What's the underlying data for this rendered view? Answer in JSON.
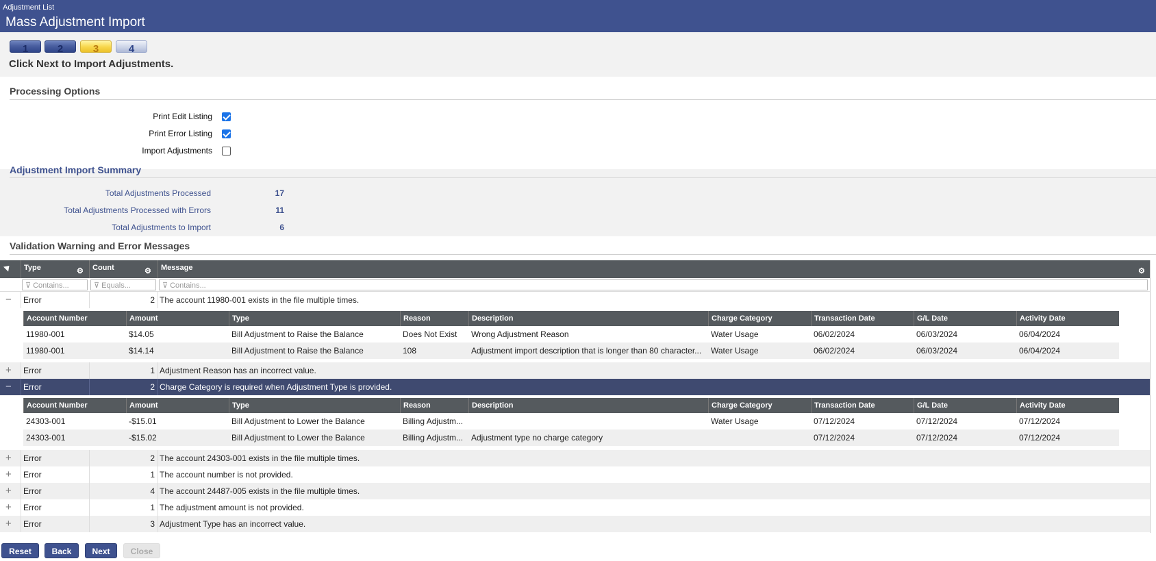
{
  "header": {
    "breadcrumb": "Adjustment List",
    "title": "Mass Adjustment Import"
  },
  "wizard": {
    "steps": [
      "1",
      "2",
      "3",
      "4"
    ],
    "current_step": 3,
    "instruction": "Click Next to Import Adjustments."
  },
  "processing_options": {
    "title": "Processing Options",
    "options": [
      {
        "label": "Print Edit Listing",
        "checked": true
      },
      {
        "label": "Print Error Listing",
        "checked": true
      },
      {
        "label": "Import Adjustments",
        "checked": false
      }
    ]
  },
  "summary": {
    "title": "Adjustment Import Summary",
    "items": [
      {
        "label": "Total Adjustments Processed",
        "value": "17"
      },
      {
        "label": "Total Adjustments Processed with Errors",
        "value": "11"
      },
      {
        "label": "Total Adjustments to Import",
        "value": "6"
      }
    ]
  },
  "validation": {
    "title": "Validation Warning and Error Messages",
    "columns": {
      "type": "Type",
      "count": "Count",
      "message": "Message"
    },
    "filters": {
      "type": "Contains...",
      "count": "Equals...",
      "message": "Contains..."
    },
    "detail_columns": [
      "Account Number",
      "Amount",
      "Type",
      "Reason",
      "Description",
      "Charge Category",
      "Transaction Date",
      "G/L Date",
      "Activity Date"
    ],
    "rows": [
      {
        "type": "Error",
        "count": "2",
        "message": "The account 11980-001 exists in the file multiple times.",
        "expanded": true,
        "details": [
          [
            "11980-001",
            "$14.05",
            "Bill Adjustment to Raise the Balance",
            "Does Not Exist",
            "Wrong Adjustment Reason",
            "Water Usage",
            "06/02/2024",
            "06/03/2024",
            "06/04/2024"
          ],
          [
            "11980-001",
            "$14.14",
            "Bill Adjustment to Raise the Balance",
            "108",
            "Adjustment import description that is longer than 80 character...",
            "Water Usage",
            "06/02/2024",
            "06/03/2024",
            "06/04/2024"
          ]
        ]
      },
      {
        "type": "Error",
        "count": "1",
        "message": "Adjustment Reason has an incorrect value.",
        "expanded": false
      },
      {
        "type": "Error",
        "count": "2",
        "message": "Charge Category is required when Adjustment Type is provided.",
        "expanded": true,
        "selected": true,
        "details": [
          [
            "24303-001",
            "-$15.01",
            "Bill Adjustment to Lower the Balance",
            "Billing Adjustm...",
            "",
            "Water Usage",
            "07/12/2024",
            "07/12/2024",
            "07/12/2024"
          ],
          [
            "24303-001",
            "-$15.02",
            "Bill Adjustment to Lower the Balance",
            "Billing Adjustm...",
            "Adjustment type no charge category",
            "",
            "07/12/2024",
            "07/12/2024",
            "07/12/2024"
          ]
        ]
      },
      {
        "type": "Error",
        "count": "2",
        "message": "The account 24303-001 exists in the file multiple times.",
        "expanded": false
      },
      {
        "type": "Error",
        "count": "1",
        "message": "The account number is not provided.",
        "expanded": false
      },
      {
        "type": "Error",
        "count": "4",
        "message": "The account 24487-005 exists in the file multiple times.",
        "expanded": false
      },
      {
        "type": "Error",
        "count": "1",
        "message": "The adjustment amount is not provided.",
        "expanded": false
      },
      {
        "type": "Error",
        "count": "3",
        "message": "Adjustment Type has an incorrect value.",
        "expanded": false
      }
    ]
  },
  "buttons": {
    "reset": "Reset",
    "back": "Back",
    "next": "Next",
    "close": "Close"
  },
  "icons": {
    "collapse": "minus-icon",
    "expand": "plus-icon",
    "gear": "gear-icon",
    "filter": "filter-icon",
    "sort": "triangle-icon"
  }
}
